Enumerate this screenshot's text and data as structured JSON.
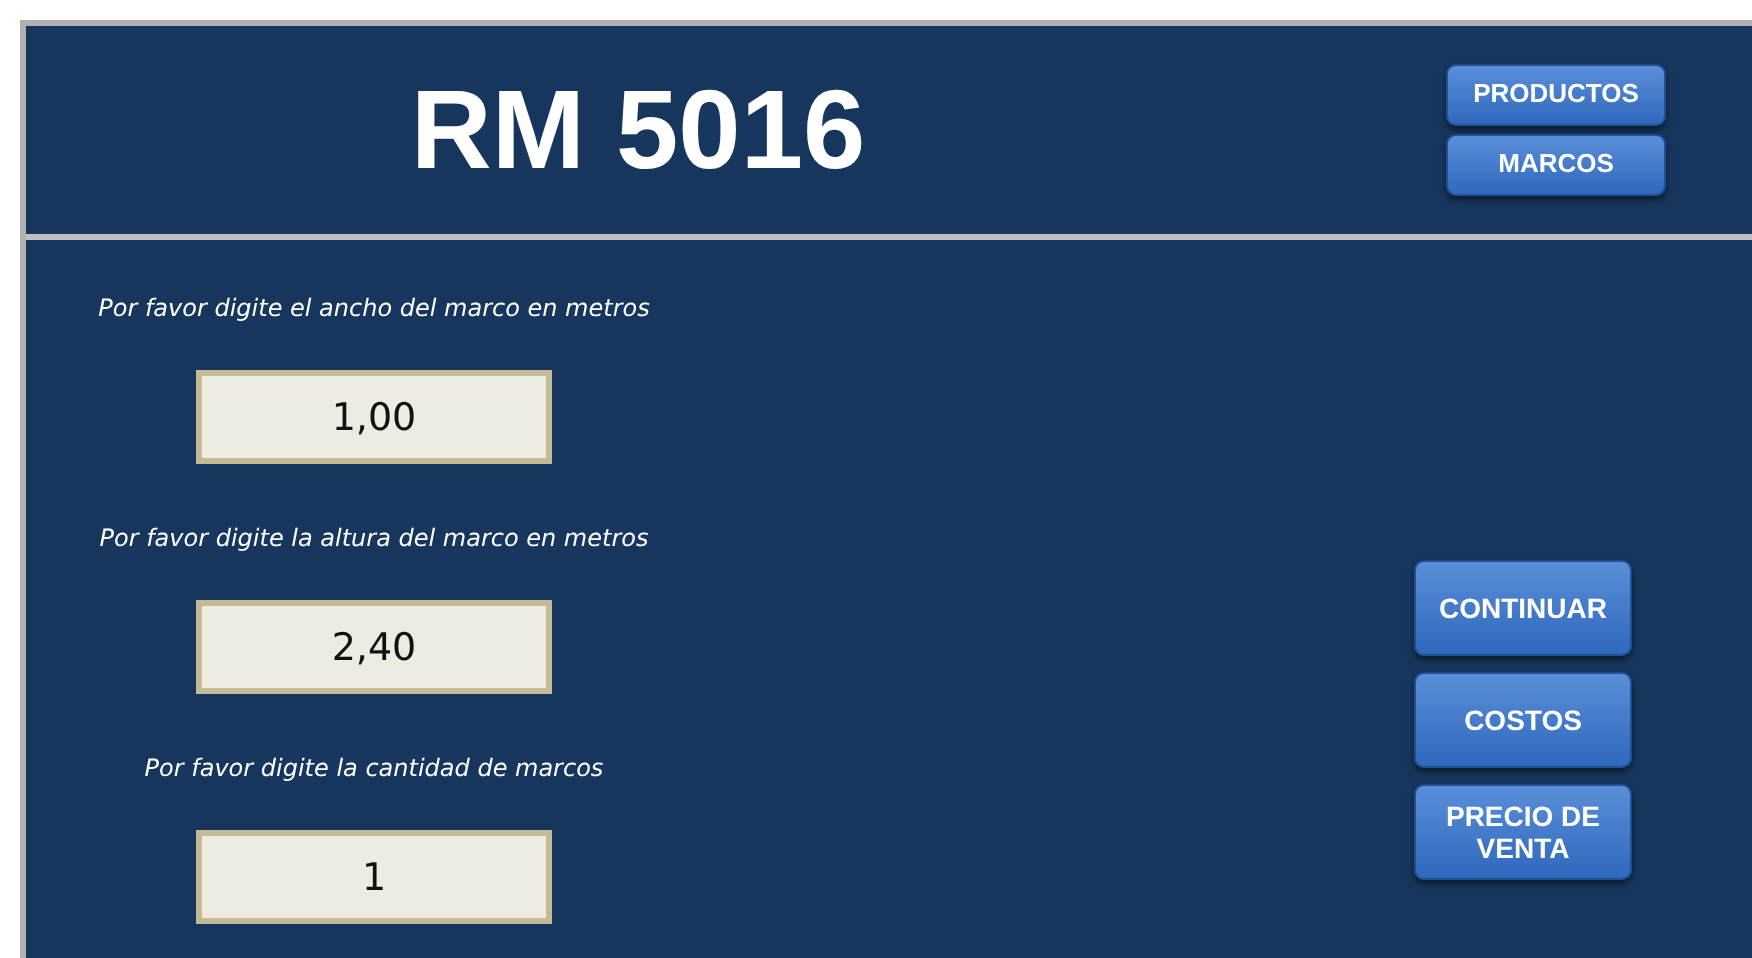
{
  "header": {
    "title": "RM 5016",
    "buttons": [
      "PRODUCTOS",
      "MARCOS"
    ]
  },
  "inputs": [
    {
      "label": "Por favor digite el ancho del marco en metros",
      "value": "1,00"
    },
    {
      "label": "Por favor digite la altura del marco en metros",
      "value": "2,40"
    },
    {
      "label": "Por favor digite la cantidad de marcos",
      "value": "1"
    }
  ],
  "actions": [
    "CONTINUAR",
    "COSTOS",
    "PRECIO DE VENTA"
  ]
}
